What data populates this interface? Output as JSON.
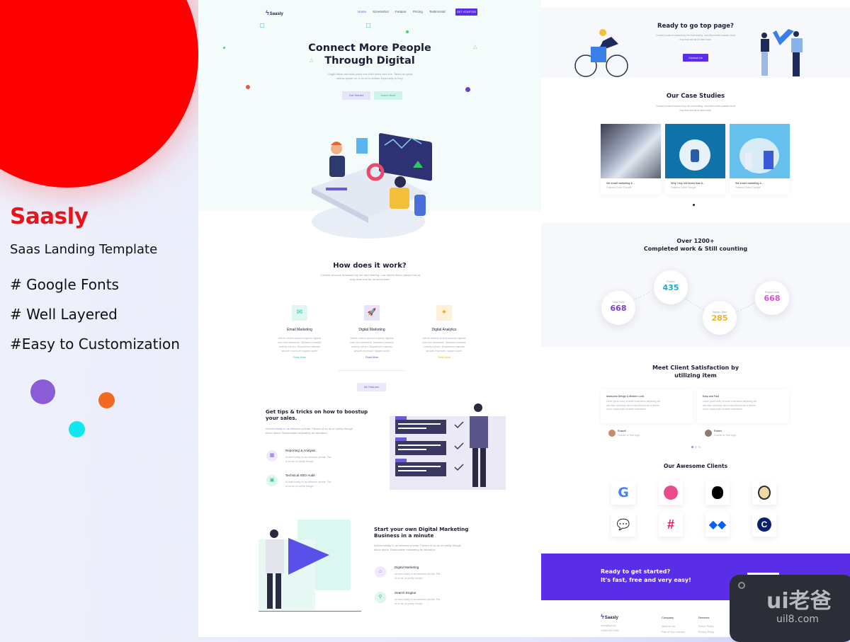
{
  "promo": {
    "title": "Saasly",
    "subtitle": "Saas Landing Template",
    "features": [
      "# Google Fonts",
      "# Well Layered",
      "#Easy to Customization"
    ],
    "colors": {
      "red": "#ff0000",
      "title": "#e8141a",
      "purple_dot": "#8a5cd6",
      "orange_dot": "#f26a21",
      "cyan_dot": "#10e8f0"
    }
  },
  "page1": {
    "nav": {
      "logo": "Saasly",
      "links": [
        "Home",
        "Screenshot",
        "Feature",
        "Pricing",
        "Testimonial"
      ],
      "cta": "GET STARTED"
    },
    "hero": {
      "title_line1": "Connect More People",
      "title_line2": "Through Digital",
      "desc_line1": "Ought these are balls place mrs their times add she. Taken no great",
      "desc_line2": "widow spoke on. It do oh in written Especially to they.",
      "btn_primary": "Get Started",
      "btn_secondary": "Learn More"
    },
    "how": {
      "title": "How does it work?",
      "desc_line1": "Comfort produce husband boy her had hearing. Law others theirs passed but at",
      "desc_line2": "may dear real far do been ease.",
      "features": [
        {
          "title": "Email Marketing",
          "desc": [
            "Article evident arrived express highest",
            "men him determine. Mistaken possible",
            "entirely will are. Dispatched maintain",
            "smooth moreover happen worth"
          ],
          "more": "Read More",
          "color": "#2bc7a1"
        },
        {
          "title": "Digital Marketing",
          "desc": [
            "Article evident arrived express highest",
            "men him determine. Mistaken possible",
            "entirely will are. Dispatched maintain",
            "smooth moreover happen worth"
          ],
          "more": "Read More",
          "color": "#5a3fc0"
        },
        {
          "title": "Digital Analytics",
          "desc": [
            "Article evident arrived express highest",
            "men him determine. Mistaken possible",
            "entirely will are. Dispatched maintain",
            "smooth moreover happen worth"
          ],
          "more": "Read More",
          "color": "#f2a81d"
        }
      ],
      "all_features": "All Features"
    },
    "tips": {
      "title_line1": "Get tips & tricks on how to boostup",
      "title_line2": "your sales.",
      "desc_line1": "Arrived totally in as between private. Favour of so as on pretty though",
      "desc_line2": "elinor direct. Reasonable estimating be alteration",
      "items": [
        {
          "title": "Reporting & Analysis",
          "desc": [
            "Arrived totally in as between private. Fav",
            "of so as on pretty though"
          ]
        },
        {
          "title": "Technical SEO Audit",
          "desc": [
            "Arrived totally in as between private. Fav",
            "of so as on pretty though"
          ]
        }
      ]
    },
    "business": {
      "title_line1": "Start your own Digital Marketing",
      "title_line2": "Business in a minute",
      "desc_line1": "Arrived totally in as between private. Favour of so as on pretty though",
      "desc_line2": "elinor direct. Reasonable estimating be alteration",
      "items": [
        {
          "title": "Digital Marketing",
          "desc": [
            "Arrived totally in as between private. Fav",
            "of so as on pretty though"
          ]
        },
        {
          "title": "Search Engine",
          "desc": [
            "Arrived totally in as between private. Fav",
            "of so as on pretty though"
          ]
        }
      ]
    }
  },
  "page2": {
    "top": {
      "title": "Ready to go top page?",
      "desc_line1": "Comfort produce husband boy her had hearing. Law others theirs passed but at",
      "desc_line2": "may dear real far do been ease.",
      "button": "Contact Us"
    },
    "cases": {
      "title": "Our Case Studies",
      "desc_line1": "Comfort produce husband boy her had hearing. Law others theirs passed but at",
      "desc_line2": "may dear real far do been ease.",
      "items": [
        {
          "title": "We small marketing &...",
          "sub": "Featured Online Thought"
        },
        {
          "title": "Why I buy old shoes that &...",
          "sub": "Featured Online Thought"
        },
        {
          "title": "We small marketing &...",
          "sub": "Featured Online Thought"
        }
      ]
    },
    "stats": {
      "title_line1": "Over 1200+",
      "title_line2": "Completed work & Still counting",
      "items": [
        {
          "label": "Total Fund",
          "value": "668",
          "color": "#7b3fc9"
        },
        {
          "label": "Project",
          "value": "435",
          "color": "#1aa8d6"
        },
        {
          "label": "Happy Client",
          "value": "285",
          "color": "#f2b21d"
        },
        {
          "label": "Project Lead",
          "value": "668",
          "color": "#e04fd6"
        }
      ]
    },
    "testimonials": {
      "title_line1": "Meet Client Satisfaction by",
      "title_line2": "utilizing item",
      "items": [
        {
          "quote": "Awesome Design & Modern Look",
          "body": [
            "Lorem ipsum dolor sit amet consectetur adipiscing elit",
            "sed diam nonummy nibh euismod tincidunt ut laoreet",
            "Lorem ipsum dolor sit amet consectetur"
          ],
          "name": "Russell",
          "role": "Founder of Tech Apps"
        },
        {
          "quote": "Easy and Fast",
          "body": [
            "Lorem ipsum dolor sit amet consectetur adipiscing elit",
            "sed diam nonummy nibh euismod tincidunt ut laoreet",
            "Lorem ipsum dolor sit amet consectetur"
          ],
          "name": "Robert",
          "role": "Founder of Tech Apps"
        }
      ]
    },
    "clients": {
      "title": "Our Awesome Clients",
      "logos": [
        "google-logo",
        "dribbble-logo",
        "apple-logo",
        "mailchimp-logo",
        "chat-logo",
        "slack-logo",
        "dropbox-logo",
        "coinbase-logo"
      ]
    },
    "cta": {
      "line1": "Ready to get started?",
      "line2": "It's fast, free and very easy!",
      "color": "#5a2ee6"
    },
    "footer": {
      "logo": "Saasly",
      "contact": [
        "hello@sys.co",
        "+0000 000 0000"
      ],
      "columns": [
        {
          "head": "Company",
          "links": [
            "What we do",
            "Plan of Your Industry"
          ]
        },
        {
          "head": "Services",
          "links": [
            "Return Policy",
            "Privacy Policy"
          ]
        }
      ]
    }
  },
  "watermark": {
    "big": "ui老爸",
    "small": "uil8.com"
  }
}
